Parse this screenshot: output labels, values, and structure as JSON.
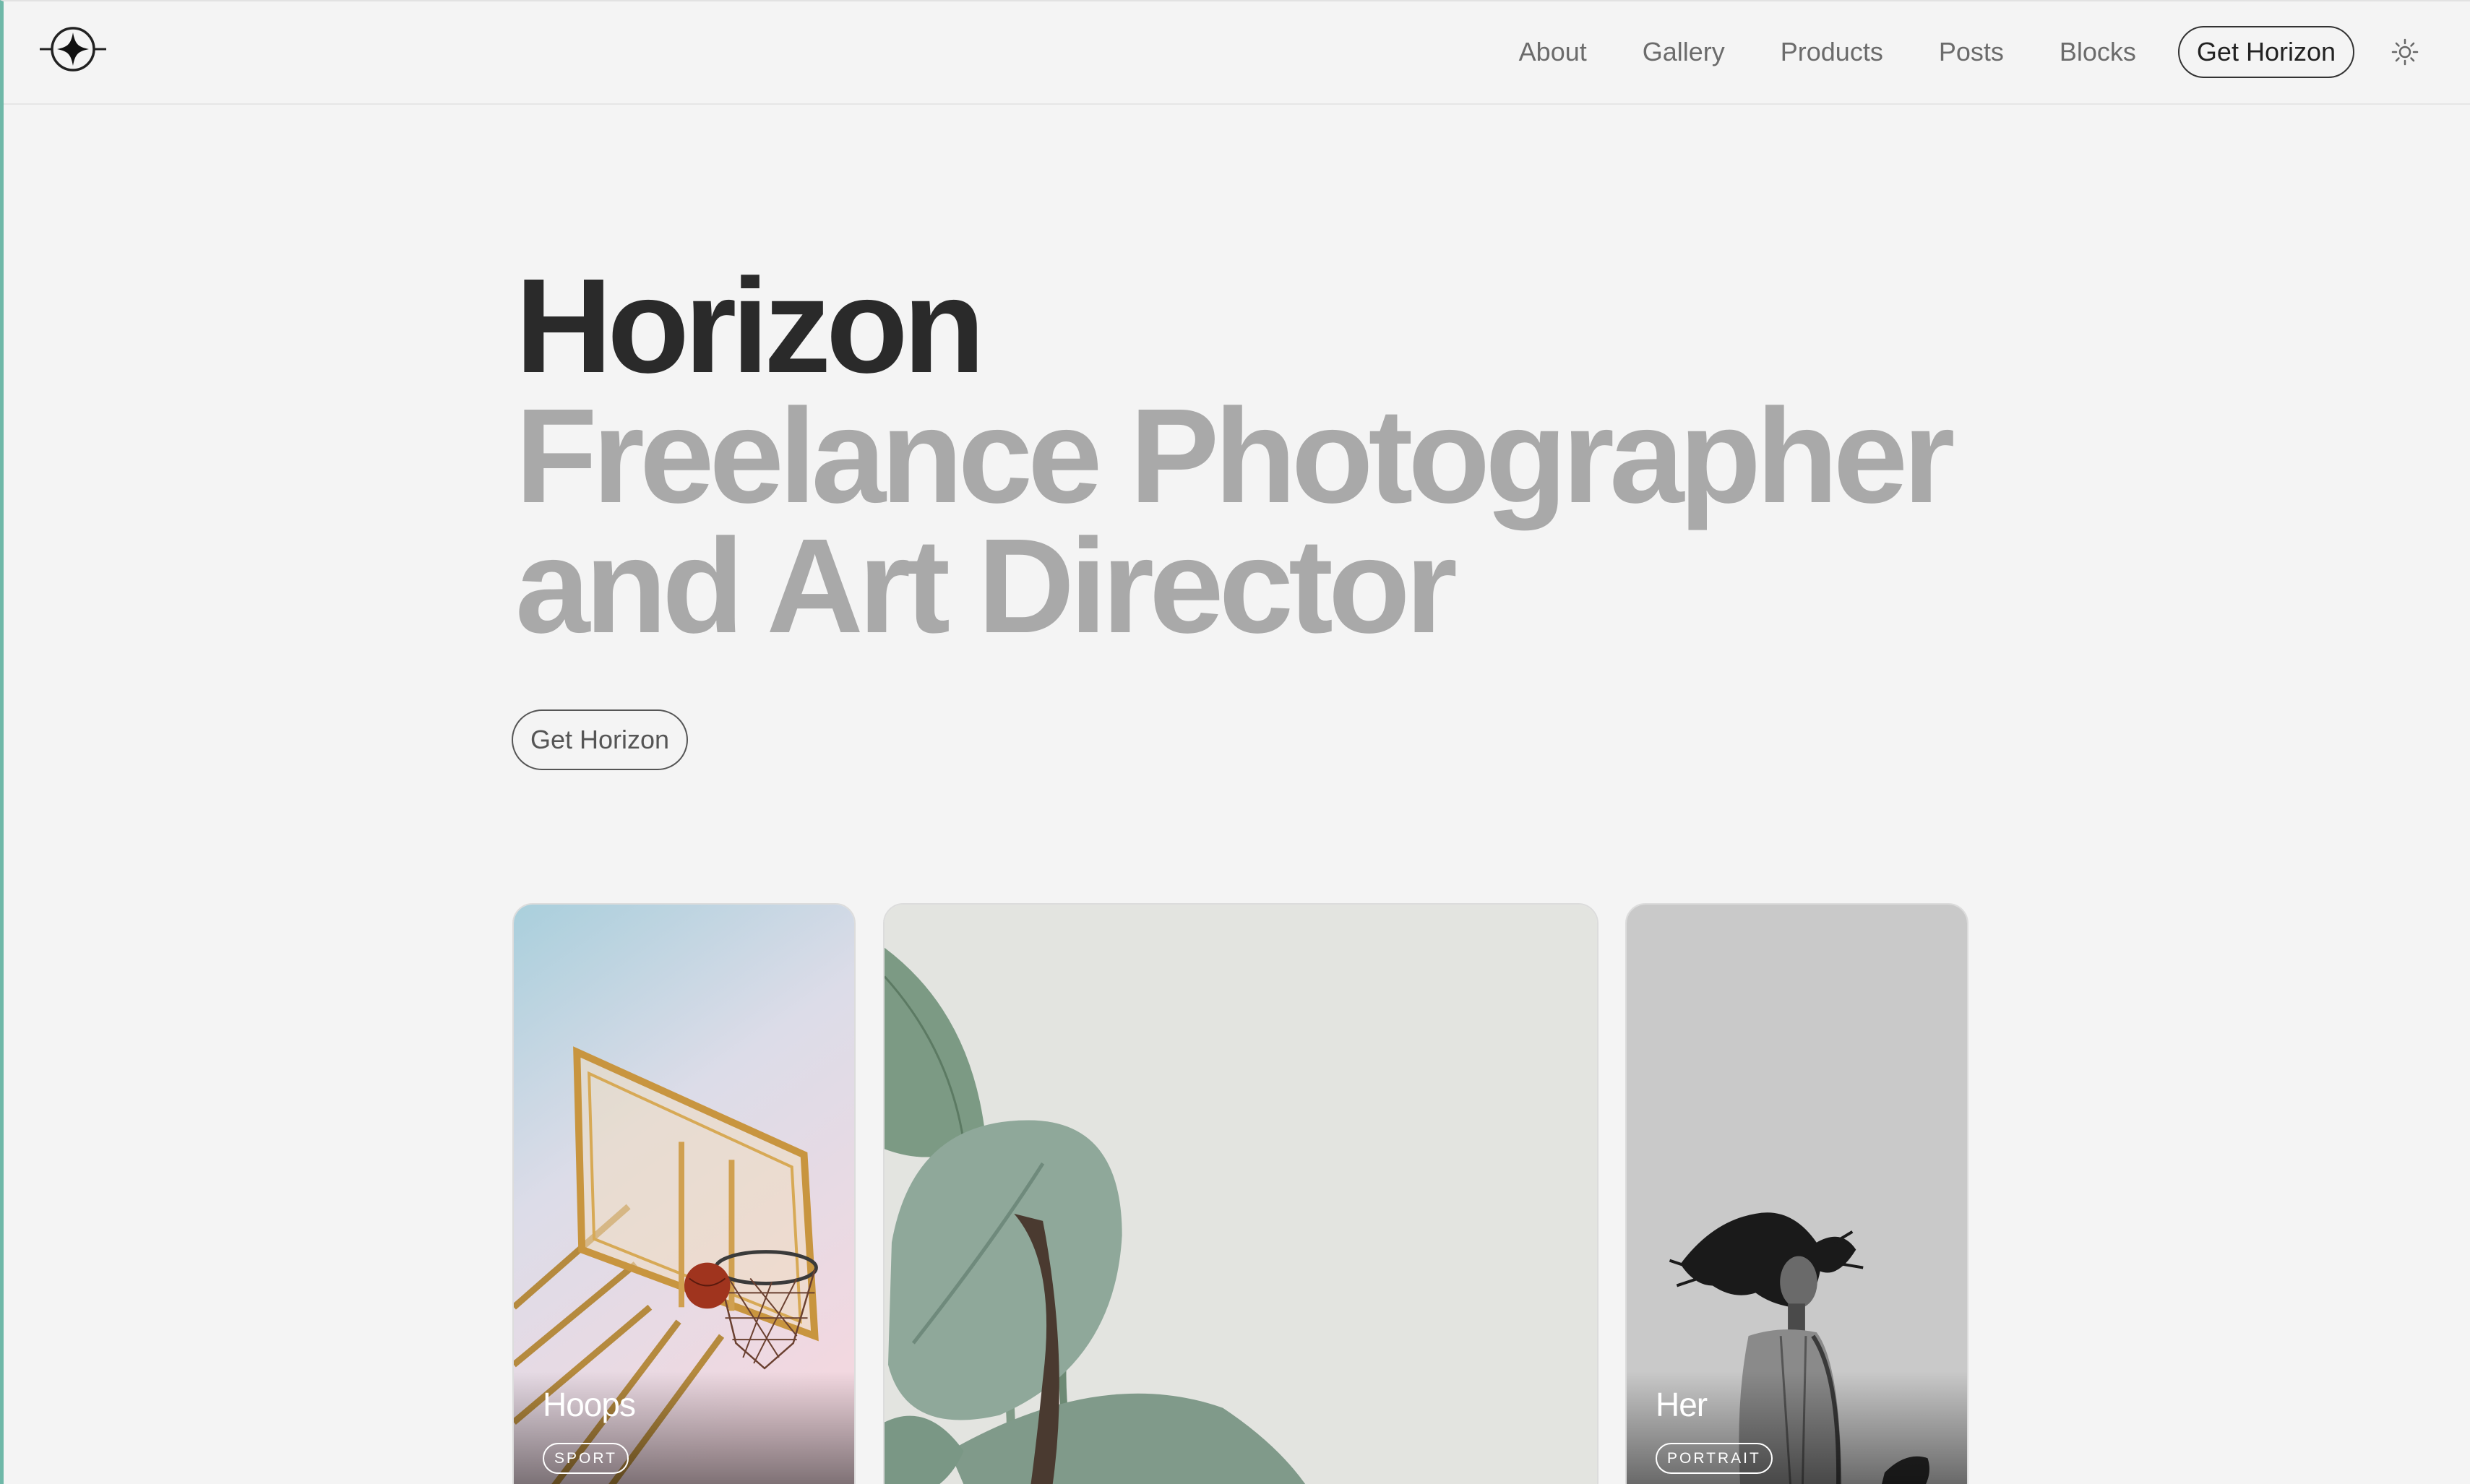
{
  "header": {
    "nav": [
      "About",
      "Gallery",
      "Products",
      "Posts",
      "Blocks"
    ],
    "cta_label": "Get Horizon"
  },
  "hero": {
    "title": "Horizon",
    "subtitle_line1": "Freelance Photographer",
    "subtitle_line2": "and Art Director",
    "button_label": "Get Horizon"
  },
  "gallery": [
    {
      "title": "Hoops",
      "tag": "SPORT"
    },
    {
      "title": "",
      "tag": ""
    },
    {
      "title": "Her",
      "tag": "PORTRAIT"
    }
  ],
  "colors": {
    "background": "#f4f4f4",
    "text": "#2a2a2a",
    "muted_text": "#a9a9a9",
    "accent_edge": "#6fb8a8"
  },
  "icons": [
    "logo-star-icon",
    "sun-icon"
  ]
}
